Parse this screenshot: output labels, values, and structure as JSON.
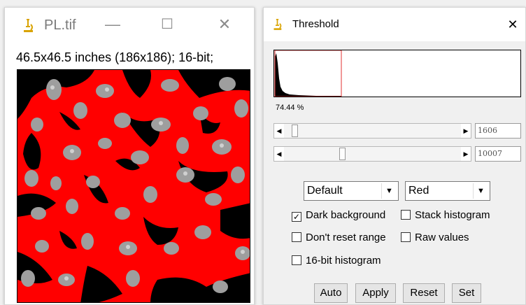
{
  "image_window": {
    "title": "PL.tif",
    "info": "46.5x46.5 inches (186x186); 16-bit;",
    "icon": "microscope-icon",
    "controls": {
      "minimize": "—",
      "maximize": "☐",
      "close": "✕"
    }
  },
  "threshold_window": {
    "title": "Threshold",
    "icon": "microscope-icon",
    "close": "✕",
    "percent": "74.44 %",
    "sliders": [
      {
        "value": "1606"
      },
      {
        "value": "10007"
      }
    ],
    "method": {
      "selected": "Default"
    },
    "display": {
      "selected": "Red"
    },
    "checkboxes": {
      "dark_background": {
        "label": "Dark background",
        "checked": true
      },
      "stack_histogram": {
        "label": "Stack histogram",
        "checked": false
      },
      "dont_reset_range": {
        "label": "Don't reset range",
        "checked": false
      },
      "raw_values": {
        "label": "Raw values",
        "checked": false
      },
      "sixteen_bit_histogram": {
        "label": "16-bit histogram",
        "checked": false
      }
    },
    "buttons": {
      "auto": "Auto",
      "apply": "Apply",
      "reset": "Reset",
      "set": "Set"
    }
  },
  "colors": {
    "threshold_red": "#ff0000",
    "nucleus_gray": "#9e9e9e",
    "background_black": "#000000",
    "icon_gold": "#d9a300"
  }
}
